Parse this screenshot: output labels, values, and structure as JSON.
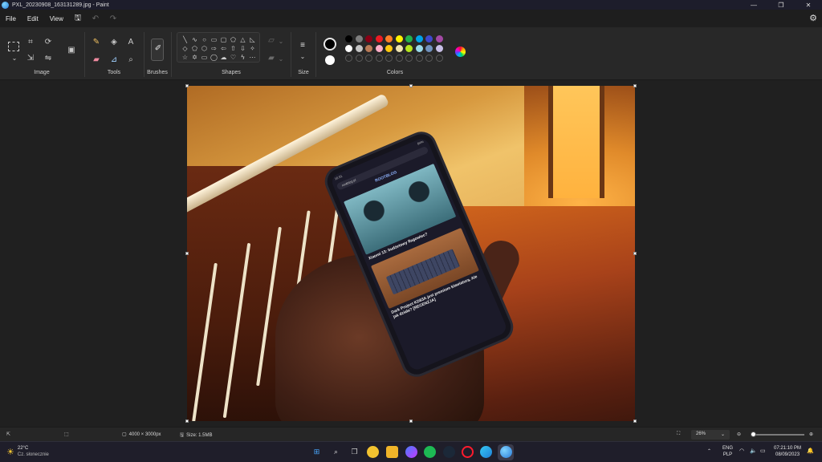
{
  "window": {
    "title": "PXL_20230908_163131289.jpg - Paint",
    "minimize": "—",
    "maximize": "❐",
    "close": "✕"
  },
  "menu": {
    "file": "File",
    "edit": "Edit",
    "view": "View"
  },
  "ribbon": {
    "groups": {
      "image": "Image",
      "tools": "Tools",
      "brushes": "Brushes",
      "shapes": "Shapes",
      "size": "Size",
      "colors": "Colors"
    }
  },
  "colors": {
    "primary": "#000000",
    "secondary": "#ffffff",
    "palette_row1": [
      "#000000",
      "#7f7f7f",
      "#880015",
      "#ed1c24",
      "#ff7f27",
      "#fff200",
      "#22b14c",
      "#00a2e8",
      "#3f48cc",
      "#a349a4"
    ],
    "palette_row2": [
      "#ffffff",
      "#c3c3c3",
      "#b97a57",
      "#ffaec9",
      "#ffc90e",
      "#efe4b0",
      "#b5e61d",
      "#99d9ea",
      "#7092be",
      "#c8bfe7"
    ]
  },
  "phone_screen": {
    "status_time": "16:31",
    "status_battery": "84%",
    "url": "rootblog.pl",
    "site_name": "ROOTBLOG",
    "article1_title": "Xiaomi 13: budżetowy flagowiec?",
    "article2_title": "Dark Project KD83A jest premium klawiaturą. Ale jak działa? [RECENZJA]"
  },
  "statusbar": {
    "dimensions": "4000 × 3000px",
    "size": "Size: 1.5MB",
    "zoom": "26%"
  },
  "taskbar": {
    "weather_temp": "22°C",
    "weather_desc": "Cz. słonecznie",
    "lang1": "ENG",
    "lang2": "PLP",
    "time": "07:21:10 PM",
    "date": "08/09/2023"
  }
}
